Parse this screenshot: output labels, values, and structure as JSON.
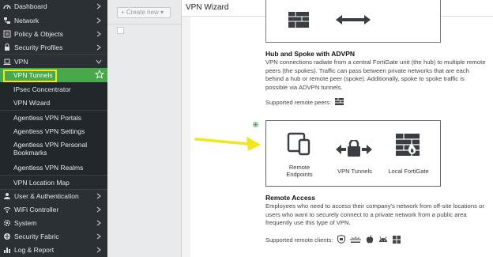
{
  "sidebar": {
    "items": [
      {
        "label": "Dashboard",
        "icon": "dashboard-icon"
      },
      {
        "label": "Network",
        "icon": "network-icon"
      },
      {
        "label": "Policy & Objects",
        "icon": "policy-icon"
      },
      {
        "label": "Security Profiles",
        "icon": "lock-icon"
      },
      {
        "label": "VPN",
        "icon": "laptop-icon"
      }
    ],
    "vpn_sub": [
      {
        "label": "VPN Tunnels"
      },
      {
        "label": "IPsec Concentrator"
      },
      {
        "label": "VPN Wizard"
      },
      {
        "label": "Agentless VPN Portals"
      },
      {
        "label": "Agentless VPN Settings"
      },
      {
        "label": "Agentless VPN Personal Bookmarks"
      },
      {
        "label": "Agentless VPN Realms"
      },
      {
        "label": "VPN Location Map"
      }
    ],
    "bottom_items": [
      {
        "label": "User & Authentication",
        "icon": "user-icon"
      },
      {
        "label": "WiFi Controller",
        "icon": "wifi-icon"
      },
      {
        "label": "System",
        "icon": "gear-icon"
      },
      {
        "label": "Security Fabric",
        "icon": "fabric-icon"
      },
      {
        "label": "Log & Report",
        "icon": "chart-icon"
      }
    ]
  },
  "background": {
    "create_new_label": "+ Create new ▾"
  },
  "wizard": {
    "title": "VPN Wizard",
    "hub": {
      "title": "Hub and Spoke with ADVPN",
      "desc": "VPN connections radiate from a central FortiGate unit (the hub) to multiple remote peers (the spokes). Traffic can pass between private networks that are each behind a hub or remote peer (spoke). Additionally, spoke to spoke traffic is possible via ADVPN tunnels.",
      "supported_label": "Supported remote peers:"
    },
    "remote": {
      "items": [
        {
          "label": "Remote Endpoints"
        },
        {
          "label": "VPN Tunnels"
        },
        {
          "label": "Local FortiGate"
        }
      ],
      "title": "Remote Access",
      "desc": "Employees who need to access their company's network from off-site locations or users who want to securely connect to a private network from a public area frequently use this type of VPN.",
      "supported_label": "Supported remote clients:"
    }
  },
  "colors": {
    "accent": "#49a84a",
    "highlight": "#f5e61a",
    "sidebar": "#2b3035"
  }
}
